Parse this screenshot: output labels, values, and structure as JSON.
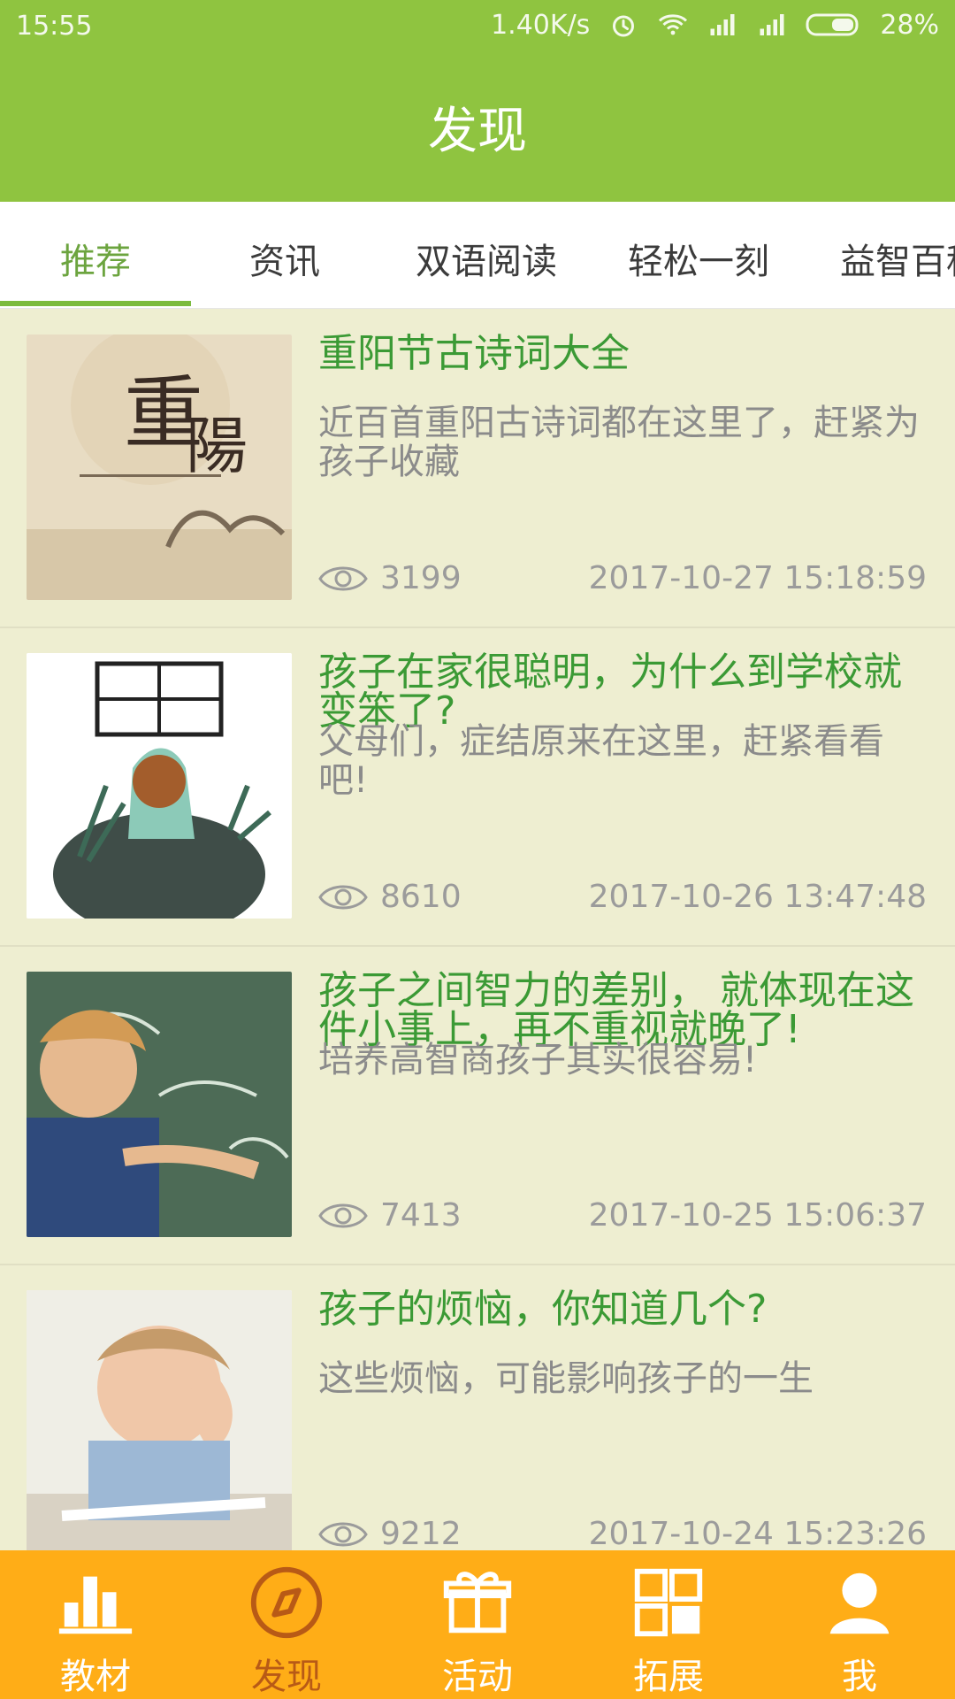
{
  "status_bar": {
    "time": "15:55",
    "network_speed": "1.40K/s",
    "battery": "28%"
  },
  "header": {
    "title": "发现",
    "background": "#8fc440"
  },
  "tabs": [
    {
      "label": "推荐",
      "active": true
    },
    {
      "label": "资讯",
      "active": false
    },
    {
      "label": "双语阅读",
      "active": false
    },
    {
      "label": "轻松一刻",
      "active": false
    },
    {
      "label": "益智百科",
      "active": false
    }
  ],
  "articles": [
    {
      "title": "重阳节古诗词大全",
      "desc": "近百首重阳古诗词都在这里了，赶紧为孩子收藏",
      "views": "3199",
      "date": "2017-10-27 15:18:59",
      "thumbnail_icon": "chongyang-illustration"
    },
    {
      "title": "孩子在家很聪明，为什么到学校就变笨了?",
      "desc": "父母们，症结原来在这里，赶紧看看吧!",
      "views": "8610",
      "date": "2017-10-26 13:47:48",
      "thumbnail_icon": "girl-window-illustration"
    },
    {
      "title": "孩子之间智力的差别， 就体现在这件小事上，再不重视就晚了!",
      "desc": "培养高智商孩子其实很容易!",
      "views": "7413",
      "date": "2017-10-25 15:06:37",
      "thumbnail_icon": "boy-blackboard-photo"
    },
    {
      "title": "孩子的烦恼，你知道几个?",
      "desc": "这些烦恼，可能影响孩子的一生",
      "views": "9212",
      "date": "2017-10-24 15:23:26",
      "thumbnail_icon": "frustrated-boy-photo"
    }
  ],
  "bottom_nav": [
    {
      "label": "教材",
      "icon": "bar-chart-icon",
      "active": false
    },
    {
      "label": "发现",
      "icon": "compass-icon",
      "active": true
    },
    {
      "label": "活动",
      "icon": "gift-icon",
      "active": false
    },
    {
      "label": "拓展",
      "icon": "grid-icon",
      "active": false
    },
    {
      "label": "我",
      "icon": "user-icon",
      "active": false
    }
  ],
  "colors": {
    "accent_green": "#6ca43f",
    "title_green": "#3b9a35",
    "bottom_nav_bg": "#ffad17",
    "active_nav": "#b85a16"
  }
}
